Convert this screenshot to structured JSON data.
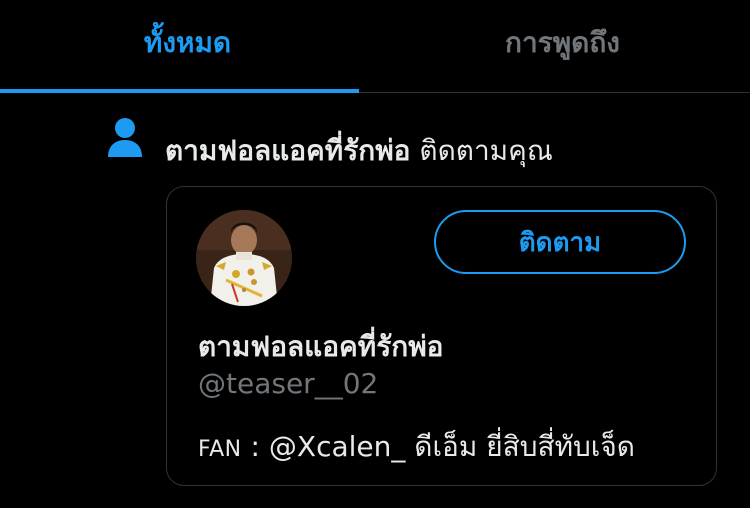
{
  "tabs": [
    {
      "label": "ทั้งหมด",
      "active": true
    },
    {
      "label": "การพูดถึง",
      "active": false
    }
  ],
  "notification": {
    "icon": "person-icon",
    "actor_name": "ตามฟอลแอคที่รักพ่อ",
    "action_text": "ติดตามคุณ"
  },
  "card": {
    "avatar": "avatar-photo",
    "follow_label": "ติดตาม",
    "display_name": "ตามฟอลแอคที่รักพ่อ",
    "handle": "@teaser__02",
    "bio_prefix": "FAN",
    "bio_rest": " : @Xcalen_ ดีเอ็ม ยี่สิบสี่ทับเจ็ด"
  },
  "colors": {
    "accent": "#1d9bf0",
    "background": "#000000",
    "muted_text": "#71767b",
    "border": "#2f3336"
  }
}
